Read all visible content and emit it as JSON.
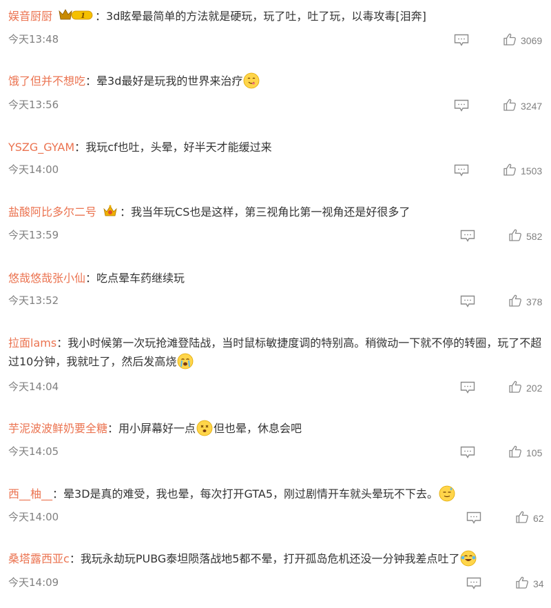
{
  "colors": {
    "username": "#eb7350",
    "text": "#333333",
    "meta": "#808080"
  },
  "separator": "：",
  "comments": [
    {
      "user": "娱音厨厨",
      "text": "3d眩晕最简单的方法就是硬玩，玩了吐，吐了玩，以毒攻毒[泪奔]",
      "time": "今天13:48",
      "likes": "3069",
      "badge": "vip-crown-badge"
    },
    {
      "user": "饿了但并不想吃",
      "text": "晕3d最好是玩我的世界来治疗",
      "time": "今天13:56",
      "likes": "3247",
      "emoji": "yum-emoji"
    },
    {
      "user": "YSZG_GYAM",
      "text": "我玩cf也吐，头晕，好半天才能缓过来",
      "time": "今天14:00",
      "likes": "1503"
    },
    {
      "user": "盐酸阿比多尔二号",
      "text": "我当年玩CS也是这样，第三视角比第一视角还是好很多了",
      "time": "今天13:59",
      "likes": "582",
      "badge": "crown-icon"
    },
    {
      "user": "悠哉悠哉张小仙",
      "text": "吃点晕车药继续玩",
      "time": "今天13:52",
      "likes": "378"
    },
    {
      "user": "拉面lams",
      "text": "我小时候第一次玩抢滩登陆战，当时鼠标敏捷度调的特别高。稍微动一下就不停的转圈，玩了不超过10分钟，我就吐了，然后发高烧",
      "time": "今天14:04",
      "likes": "202",
      "emoji": "crying-emoji"
    },
    {
      "user": "芋泥波波鲜奶要全糖",
      "text_a": "用小屏幕好一点",
      "text_b": "但也晕，休息会吧",
      "time": "今天14:05",
      "likes": "105",
      "emoji": "dizzy-emoji"
    },
    {
      "user": "西__柚__",
      "text": "晕3D是真的难受，我也晕，每次打开GTA5，刚过剧情开车就头晕玩不下去。",
      "time": "今天14:00",
      "likes": "62",
      "emoji": "sweat-emoji"
    },
    {
      "user": "桑塔露西亚c",
      "text": "我玩永劫玩PUBG泰坦陨落战地5都不晕，打开孤岛危机还没一分钟我差点吐了",
      "time": "今天14:09",
      "likes": "34",
      "emoji": "laugh-cry-emoji"
    }
  ]
}
